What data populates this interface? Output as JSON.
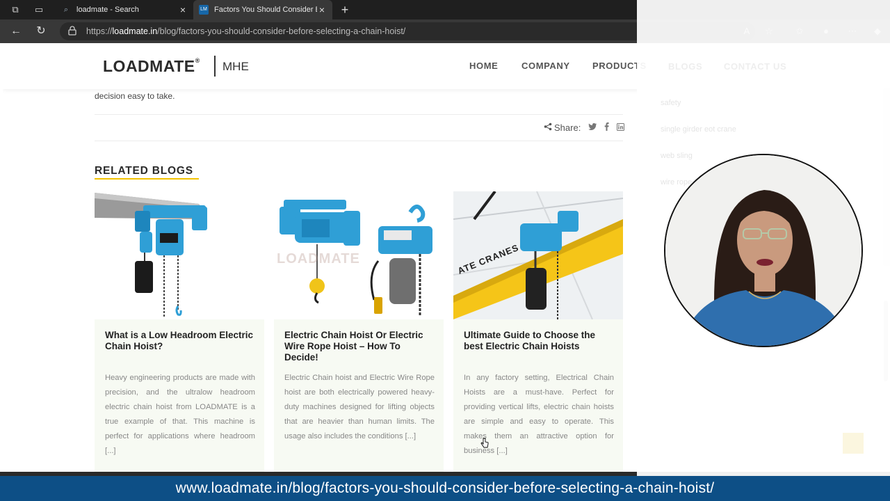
{
  "browser": {
    "tabs": [
      {
        "title": "loadmate - Search"
      },
      {
        "title": "Factors You Should Consider Befo"
      }
    ],
    "url_prefix": "https://",
    "url_domain": "loadmate.in",
    "url_path": "/blog/factors-you-should-consider-before-selecting-a-chain-hoist/"
  },
  "site": {
    "logo": "LOADMATE",
    "logo_mark": "®",
    "logo_sub": "MHE",
    "nav": [
      "HOME",
      "COMPANY",
      "PRODUCTS",
      "BLOGS",
      "CONTACT US"
    ]
  },
  "article": {
    "intro_tail": "decision easy to take.",
    "share_label": "Share:"
  },
  "related": {
    "heading": "RELATED BLOGS",
    "cards": [
      {
        "title": "What is a Low Headroom Electric Chain Hoist?",
        "excerpt": "Heavy engineering products are made with precision, and the ultralow headroom electric chain hoist from LOADMATE is a true example of that. This machine is perfect for applications where headroom [...]"
      },
      {
        "title": "Electric Chain Hoist Or Electric Wire Rope Hoist – How To Decide!",
        "excerpt": "Electric Chain hoist and Electric Wire Rope hoist are both electrically powered heavy-duty machines designed for lifting objects that are heavier than human limits. The usage also includes the conditions [...]"
      },
      {
        "title": "Ultimate Guide to Choose the best Electric Chain Hoists",
        "excerpt": "In any factory setting, Electrical Chain Hoists are a must-have. Perfect for providing vertical lifts, electric chain hoists are simple and easy to operate. This makes them an attractive option for business [...]"
      }
    ],
    "card2_watermark": "LOADMATE",
    "card3_beam_text": "ATE CRANES"
  },
  "sidebar_tags": [
    "safety",
    "single girder eot crane",
    "web sling",
    "wire rope"
  ],
  "footer_url": "www.loadmate.in/blog/factors-you-should-consider-before-selecting-a-chain-hoist/",
  "colors": {
    "accent": "#f2c200",
    "footer": "#0d4f86",
    "hoist_blue": "#2f9fd6"
  }
}
